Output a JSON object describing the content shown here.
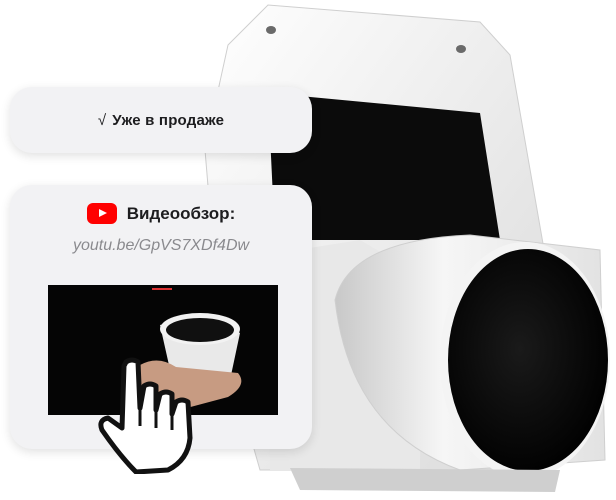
{
  "status_chip": {
    "check": "√",
    "label": "Уже в продаже"
  },
  "video_card": {
    "title": "Видеообзор:",
    "link": "youtu.be/GpVS7XDf4Dw",
    "icon": "youtube-icon"
  },
  "colors": {
    "youtube_red": "#ff0000",
    "card_bg": "#f2f2f4",
    "link_gray": "#8a8a8e"
  }
}
